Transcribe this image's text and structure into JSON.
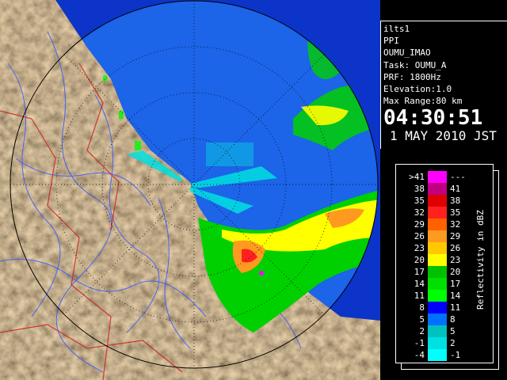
{
  "info": {
    "lines": [
      "ilts1",
      "PPI",
      "OUMU_IMAO",
      "Task: OUMU_A",
      "PRF: 1800Hz",
      "Elevation:1.0",
      "Max Range:80 km"
    ],
    "time": "04:30:51",
    "date": "1 MAY 2010 JST"
  },
  "legend": {
    "unit": "Reflectivity in dBZ",
    "rows": [
      {
        "lo": ">41",
        "hi": "---",
        "color": "#ff00ff"
      },
      {
        "lo": "38",
        "hi": "41",
        "color": "#c00080"
      },
      {
        "lo": "35",
        "hi": "38",
        "color": "#e00000"
      },
      {
        "lo": "32",
        "hi": "35",
        "color": "#ff2020"
      },
      {
        "lo": "29",
        "hi": "32",
        "color": "#ff6000"
      },
      {
        "lo": "26",
        "hi": "29",
        "color": "#ff9a20"
      },
      {
        "lo": "23",
        "hi": "26",
        "color": "#ffc800"
      },
      {
        "lo": "20",
        "hi": "23",
        "color": "#ffff00"
      },
      {
        "lo": "17",
        "hi": "20",
        "color": "#00c000"
      },
      {
        "lo": "14",
        "hi": "17",
        "color": "#00e000"
      },
      {
        "lo": "11",
        "hi": "14",
        "color": "#00ff00"
      },
      {
        "lo": "8",
        "hi": "11",
        "color": "#0000ff"
      },
      {
        "lo": "5",
        "hi": "8",
        "color": "#0070ff"
      },
      {
        "lo": "2",
        "hi": "5",
        "color": "#00c0c0"
      },
      {
        "lo": "-1",
        "hi": "2",
        "color": "#00e0e0"
      },
      {
        "lo": "-4",
        "hi": "-1",
        "color": "#00ffff"
      }
    ]
  },
  "colors": {
    "sea": "#1c64e8",
    "outer_sea": "#0c34c8",
    "land": "#8a6f4e",
    "river": "#3a5cff",
    "border": "#d02020"
  }
}
